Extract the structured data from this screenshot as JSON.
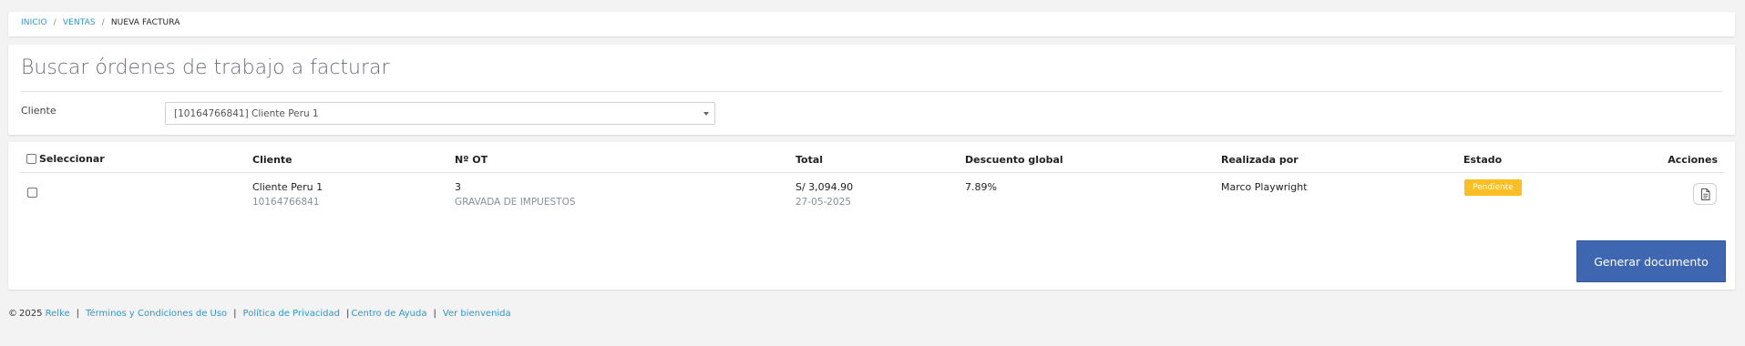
{
  "breadcrumb": {
    "items": [
      "INICIO",
      "VENTAS"
    ],
    "current": "NUEVA FACTURA",
    "separator": "/"
  },
  "search": {
    "title": "Buscar órdenes de trabajo a facturar",
    "client_label": "Cliente",
    "client_value": "[10164766841] Cliente Peru 1"
  },
  "table": {
    "headers": {
      "select": "Seleccionar",
      "client": "Cliente",
      "ot": "Nº OT",
      "total": "Total",
      "discount": "Descuento global",
      "made_by": "Realizada por",
      "status": "Estado",
      "actions": "Acciones"
    },
    "rows": [
      {
        "client_name": "Cliente Peru 1",
        "client_id": "10164766841",
        "ot_number": "3",
        "ot_type": "GRAVADA DE IMPUESTOS",
        "total": "S/ 3,094.90",
        "date": "27-05-2025",
        "discount": "7.89%",
        "made_by": "Marco Playwright",
        "status": "Pendiente",
        "action_icon": "document-icon"
      }
    ]
  },
  "generate_button": "Generar documento",
  "footer": {
    "copyright_symbol": "©",
    "year": "2025",
    "brand": "Relke",
    "links": [
      "Términos y Condiciones de Uso",
      "Política de Privacidad",
      "Centro de Ayuda",
      "Ver bienvenida"
    ]
  },
  "colors": {
    "link": "#2f98c8",
    "status_pending": "#fbbf24",
    "primary_button": "#3f66b0"
  }
}
